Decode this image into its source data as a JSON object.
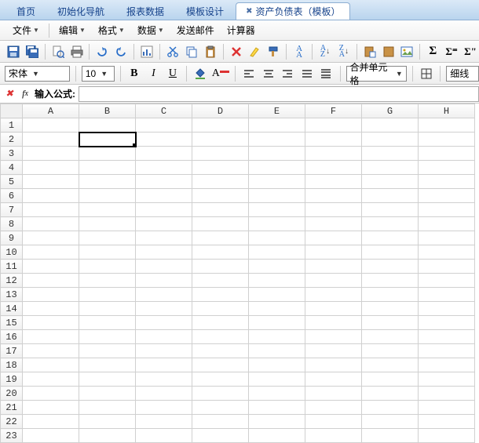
{
  "tabs": [
    {
      "label": "首页"
    },
    {
      "label": "初始化导航"
    },
    {
      "label": "报表数据"
    },
    {
      "label": "模板设计"
    },
    {
      "label": "资产负债表（模板）",
      "active": true,
      "closable": true
    }
  ],
  "menus": [
    {
      "label": "文件"
    },
    {
      "label": "编辑"
    },
    {
      "label": "格式"
    },
    {
      "label": "数据"
    },
    {
      "label": "发送邮件",
      "no_caret": true
    },
    {
      "label": "计算器",
      "no_caret": true
    }
  ],
  "font": {
    "family": "宋体",
    "size": "10"
  },
  "merge_label": "合并单元格",
  "border_label": "细线",
  "formula": {
    "label": "输入公式:",
    "value": ""
  },
  "columns": [
    "A",
    "B",
    "C",
    "D",
    "E",
    "F",
    "G",
    "H"
  ],
  "rows": [
    "1",
    "2",
    "3",
    "4",
    "5",
    "6",
    "7",
    "8",
    "9",
    "10",
    "11",
    "12",
    "13",
    "14",
    "15",
    "16",
    "17",
    "18",
    "19",
    "20",
    "21",
    "22",
    "23"
  ],
  "selected": {
    "row": "2",
    "col": "B"
  }
}
